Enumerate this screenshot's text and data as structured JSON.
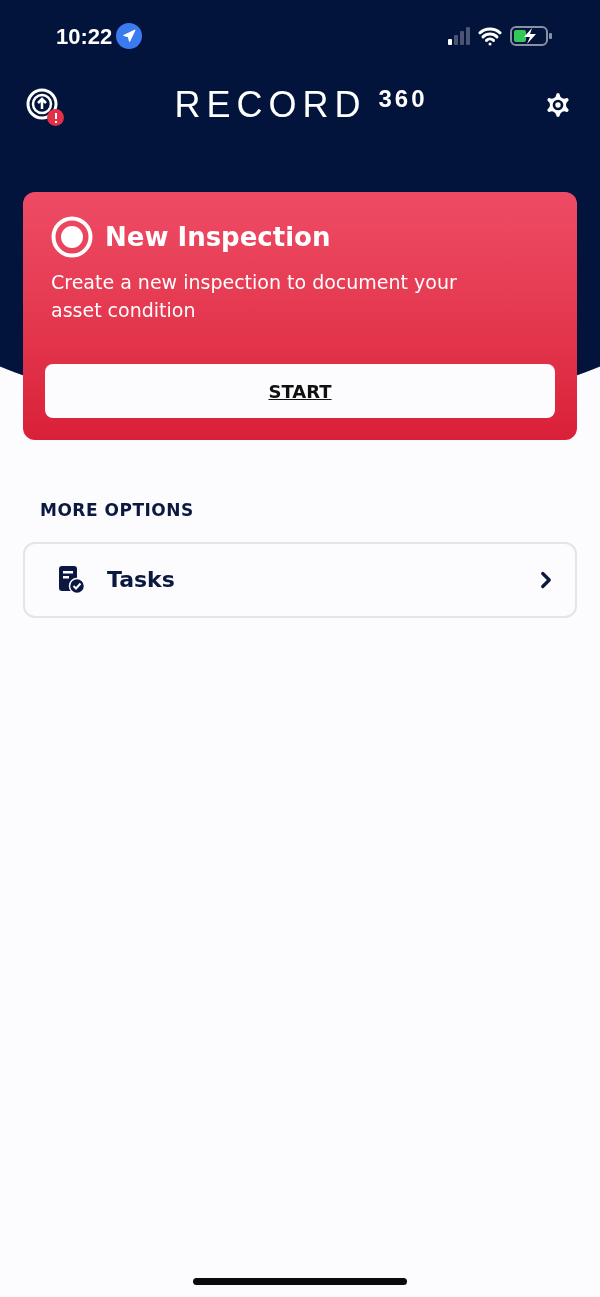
{
  "status_bar": {
    "time": "10:22"
  },
  "header": {
    "logo": "RECORD",
    "logo_suffix": "360",
    "sync_alert": true
  },
  "hero_card": {
    "title": "New Inspection",
    "description": "Create a new inspection to document your asset condition",
    "button": "START"
  },
  "more_options": {
    "heading": "MORE OPTIONS",
    "items": [
      {
        "label": "Tasks"
      }
    ]
  }
}
